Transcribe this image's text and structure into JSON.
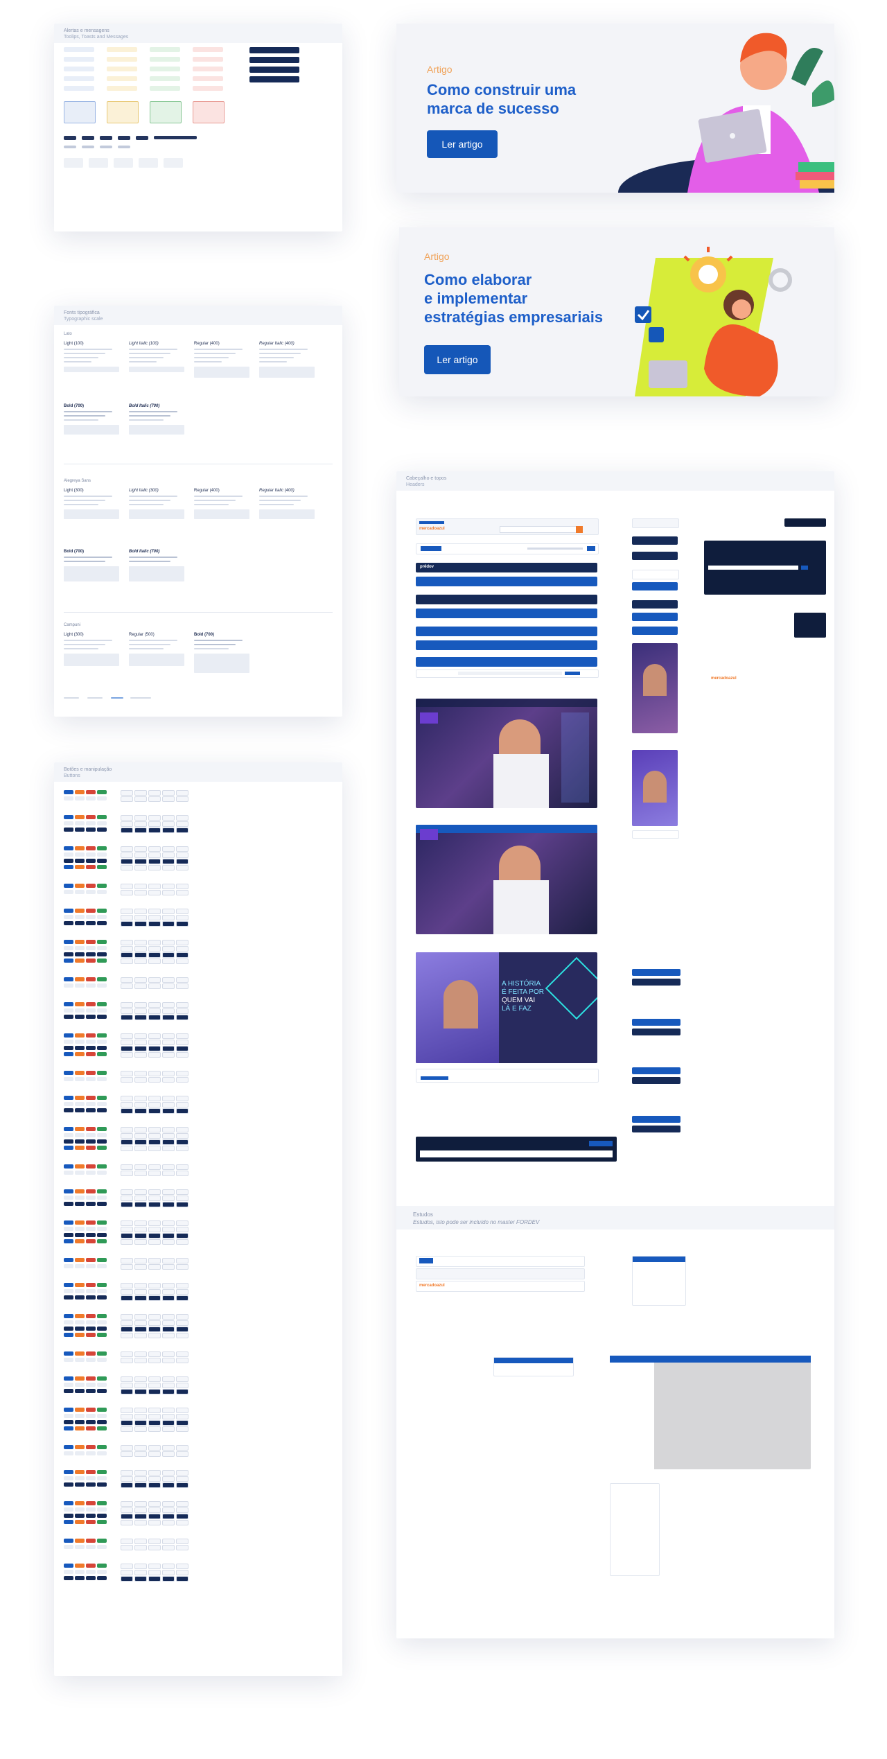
{
  "colors": {
    "brand_blue": "#1557b8",
    "title_blue": "#1e5fc9",
    "accent_orange": "#f0a35a",
    "navy": "#152a57",
    "dark": "#0f1d3c"
  },
  "sections": {
    "alerts": {
      "title": "Alertas e mensagens",
      "subtitle": "Toolips, Toasts and Messages"
    },
    "fonts": {
      "title": "Fonts tipográfica",
      "subtitle": "Typographic scale",
      "family_lato": "Lato",
      "family_alegreya": "Alegreya Sans",
      "family_campuni": "Campuni",
      "lato_weights": [
        "Light (100)",
        "Light Italic (100)",
        "Regular (400)",
        "Regular Italic (400)",
        "Bold (700)",
        "Bold Italic (700)"
      ],
      "alegreya_weights": [
        "Light (300)",
        "Light Italic (300)",
        "Regular (400)",
        "Regular Italic (400)",
        "Bold (700)",
        "Bold Italic (700)"
      ],
      "campuni_weights": [
        "Light (300)",
        "Regular (500)",
        "Bold (700)"
      ]
    },
    "buttons": {
      "title": "Botões e manipulação",
      "subtitle": "Buttons"
    },
    "headers": {
      "title": "Cabeçalho e topos",
      "subtitle": "Headers"
    },
    "studies": {
      "title": "Estudos",
      "subtitle": "Estudos, isto pode ser incluído no master FORDEV"
    }
  },
  "banner1": {
    "tag": "Artigo",
    "title_l1": "Como construir uma",
    "title_l2": "marca de sucesso",
    "cta": "Ler artigo"
  },
  "banner2": {
    "tag": "Artigo",
    "title_l1": "Como elaborar",
    "title_l2": "e implementar",
    "title_l3": "estratégias empresariais",
    "cta": "Ler artigo"
  },
  "promo": {
    "line1": "A HISTÓRIA",
    "line2": "É FEITA POR",
    "line3": "QUEM VAI",
    "line4": "LÁ E FAZ"
  },
  "brands": {
    "mercado": "mercadoazul",
    "produto": "prêdov"
  }
}
